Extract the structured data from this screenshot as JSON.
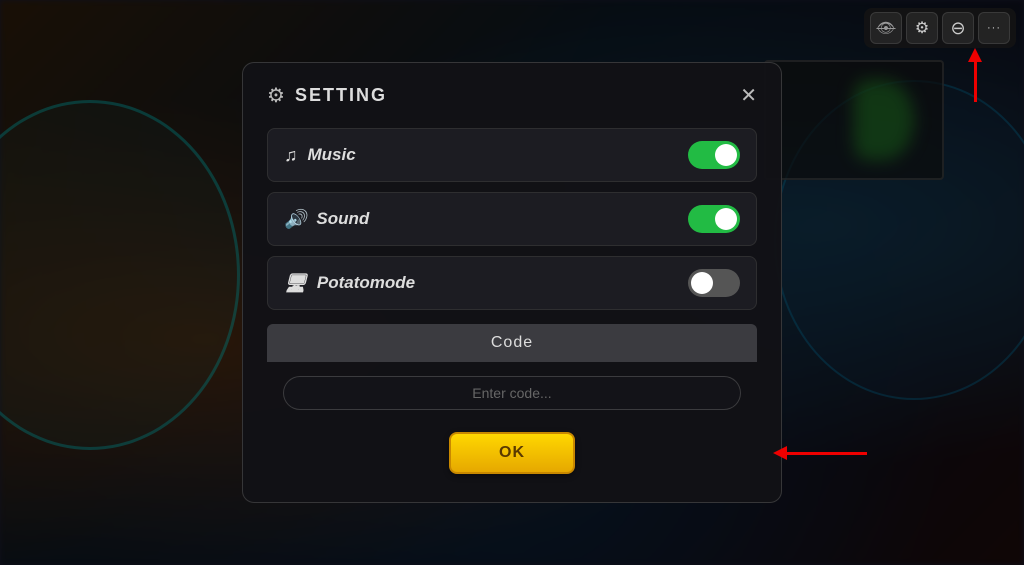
{
  "background": {
    "description": "Blurred game lobby background"
  },
  "toolbar": {
    "buttons": [
      {
        "id": "ui-toggle",
        "icon": "👁",
        "label": "UI Toggle"
      },
      {
        "id": "settings",
        "icon": "⚙",
        "label": "Settings"
      },
      {
        "id": "account",
        "icon": "⊖",
        "label": "Account"
      },
      {
        "id": "more",
        "icon": "•••",
        "label": "More"
      }
    ]
  },
  "modal": {
    "title": "SETTING",
    "close_label": "✕",
    "toggles": [
      {
        "id": "music",
        "icon": "♫",
        "label": "Music",
        "state": "on"
      },
      {
        "id": "sound",
        "icon": "🔊",
        "label": "Sound",
        "state": "on"
      },
      {
        "id": "potato",
        "icon": "🖥",
        "label": "Potatomode",
        "state": "off"
      }
    ],
    "code_section": {
      "header": "Code",
      "input_placeholder": "Enter code...",
      "ok_label": "OK"
    }
  },
  "arrows": {
    "gear_arrow_description": "Red arrow pointing up to gear icon",
    "ok_arrow_description": "Red arrow pointing left to OK button"
  }
}
